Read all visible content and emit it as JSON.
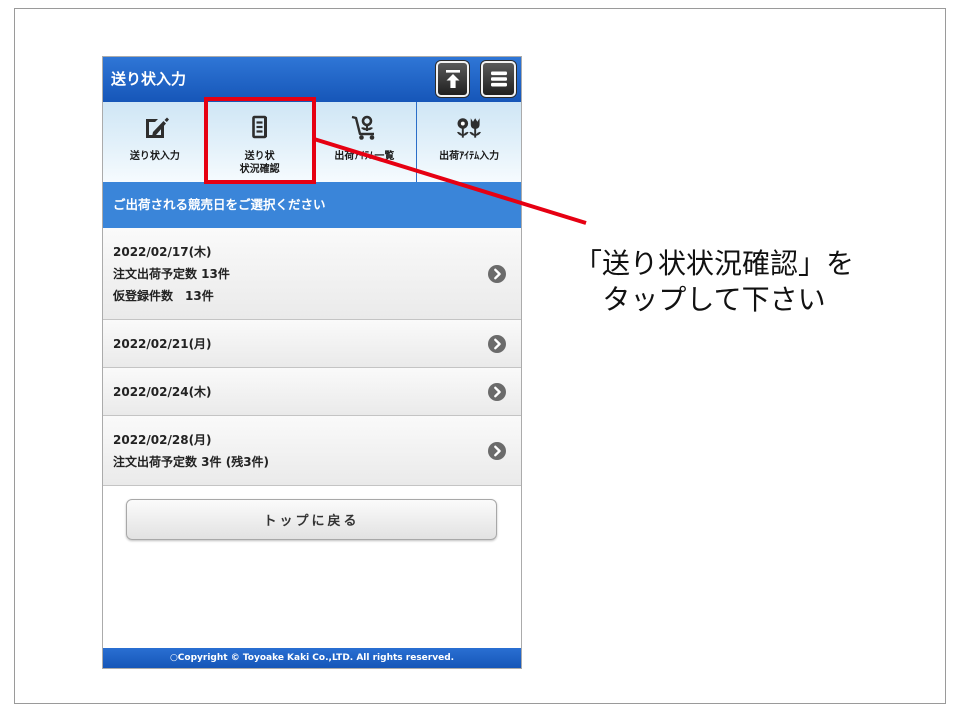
{
  "header": {
    "title": "送り状入力",
    "left_icon": "scroll-to-top-icon",
    "right_icon": "menu-icon"
  },
  "tabs": [
    {
      "icon": "edit-icon",
      "lines": [
        "送り状入力"
      ]
    },
    {
      "icon": "document-icon",
      "lines": [
        "送り状",
        "状況確認"
      ]
    },
    {
      "icon": "plant-cart-icon",
      "lines": [
        "出荷ｱｲﾃﾑ一覧"
      ]
    },
    {
      "icon": "flower-icon",
      "lines": [
        "出荷ｱｲﾃﾑ入力"
      ]
    }
  ],
  "section_title": "ご出荷される競売日をご選択ください",
  "dates": [
    {
      "date": "2022/02/17(木)",
      "lines": [
        "注文出荷予定数 13件",
        "仮登録件数　13件"
      ]
    },
    {
      "date": "2022/02/21(月)",
      "lines": []
    },
    {
      "date": "2022/02/24(木)",
      "lines": []
    },
    {
      "date": "2022/02/28(月)",
      "lines": [
        "注文出荷予定数 3件 (残3件)"
      ]
    }
  ],
  "list_icon": "chevron-right-icon",
  "back_button": {
    "label": "トップに戻る"
  },
  "footer": {
    "copyright": "○Copyright © Toyoake Kaki Co.,LTD. All rights reserved."
  },
  "callout": {
    "lines": [
      "「送り状状況確認」を",
      "タップして下さい"
    ]
  },
  "colors": {
    "header_blue": "#1c60c2",
    "section_blue": "#3a85d9",
    "highlight_red": "#e60012",
    "tab_bg": "#d4eaf6"
  }
}
